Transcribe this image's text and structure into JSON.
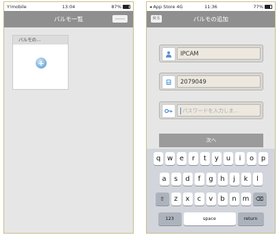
{
  "left": {
    "status": {
      "carrier": "Y!mobile",
      "time": "13:04",
      "battery": "87%",
      "battery_level": 0.87
    },
    "navbar": {
      "title": "バルモ一覧"
    },
    "device_card": {
      "title": "バルモの…",
      "add_icon": "plus-circle-icon"
    }
  },
  "right": {
    "status": {
      "carrier": "◂ App Store",
      "network": "4G",
      "time": "11:36",
      "battery": "77%",
      "battery_level": 0.77
    },
    "navbar": {
      "title": "バルモの追加",
      "back_label": "戻る"
    },
    "form": {
      "name_value": "IPCAM",
      "id_value": "2079049",
      "password_placeholder": "パスワードを入力しま…",
      "next_label": "次へ"
    },
    "keyboard": {
      "row1": [
        "q",
        "w",
        "e",
        "r",
        "t",
        "y",
        "u",
        "i",
        "o",
        "p"
      ],
      "row2": [
        "a",
        "s",
        "d",
        "f",
        "g",
        "h",
        "j",
        "k",
        "l"
      ],
      "row3": [
        "z",
        "x",
        "c",
        "v",
        "b",
        "n",
        "m"
      ],
      "num_label": "123",
      "space_label": "space",
      "return_label": "return",
      "shift_icon": "⇧",
      "delete_icon": "⌫"
    }
  },
  "colors": {
    "navbar": "#8f8f8f",
    "accent": "#4f8cbd",
    "frame": "#c8bb86"
  }
}
